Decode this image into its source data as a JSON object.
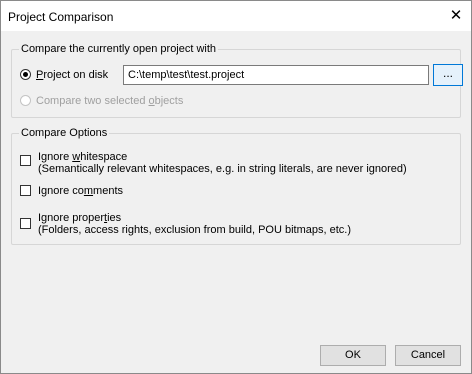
{
  "window": {
    "title": "Project Comparison",
    "close_glyph": "✕"
  },
  "compare_group": {
    "label": "Compare the currently open project with",
    "option_disk": {
      "pre": "",
      "accel": "P",
      "post": "roject on disk",
      "selected": true
    },
    "path_value": "C:\\temp\\test\\test.project",
    "browse_label": "...",
    "option_objects": {
      "pre": "Compare two selected ",
      "accel": "o",
      "post": "bjects",
      "enabled": false
    }
  },
  "options_group": {
    "label": "Compare Options",
    "whitespace": {
      "pre": "Ignore ",
      "accel": "w",
      "post": "hitespace",
      "description": "(Semantically relevant whitespaces, e.g. in string literals, are never ignored)",
      "checked": false
    },
    "comments": {
      "pre": "Ignore co",
      "accel": "m",
      "post": "ments",
      "checked": false
    },
    "properties": {
      "pre": "Ignore proper",
      "accel": "t",
      "post": "ies",
      "description": "(Folders, access rights, exclusion from build, POU bitmaps, etc.)",
      "checked": false
    }
  },
  "buttons": {
    "ok": "OK",
    "cancel": "Cancel"
  }
}
